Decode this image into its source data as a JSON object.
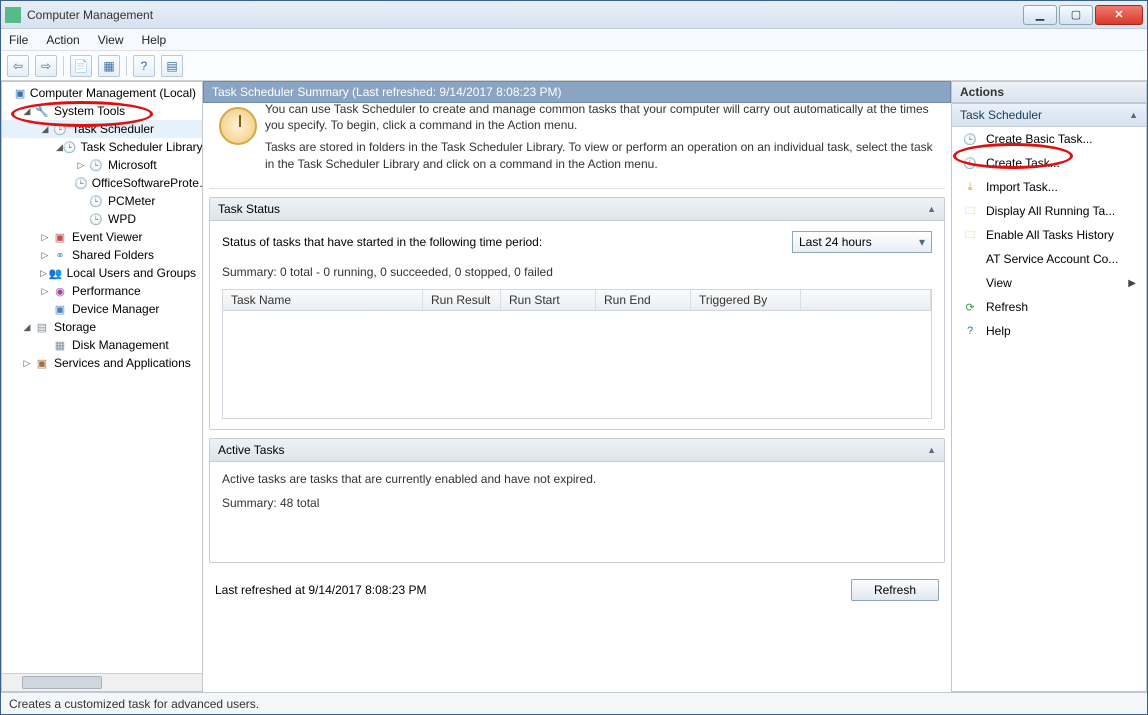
{
  "titlebar": {
    "title": "Computer Management"
  },
  "menubar": {
    "file": "File",
    "action": "Action",
    "view": "View",
    "help": "Help"
  },
  "tree": {
    "root": "Computer Management (Local)",
    "systools": "System Tools",
    "tasksched": "Task Scheduler",
    "tslib": "Task Scheduler Library",
    "microsoft": "Microsoft",
    "office": "OfficeSoftwareProte…",
    "pcmeter": "PCMeter",
    "wpd": "WPD",
    "event": "Event Viewer",
    "shared": "Shared Folders",
    "users": "Local Users and Groups",
    "perf": "Performance",
    "device": "Device Manager",
    "storage": "Storage",
    "disk": "Disk Management",
    "serv": "Services and Applications"
  },
  "center": {
    "header": "Task Scheduler Summary (Last refreshed: 9/14/2017 8:08:23 PM)",
    "intro1": "You can use Task Scheduler to create and manage common tasks that your computer will carry out automatically at the times you specify. To begin, click a command in the Action menu.",
    "intro2": "Tasks are stored in folders in the Task Scheduler Library. To view or perform an operation on an individual task, select the task in the Task Scheduler Library and click on a command in the Action menu.",
    "taskStatus": {
      "title": "Task Status",
      "label": "Status of tasks that have started in the following time period:",
      "period": "Last 24 hours",
      "summary": "Summary: 0 total - 0 running, 0 succeeded, 0 stopped, 0 failed",
      "cols": {
        "name": "Task Name",
        "result": "Run Result",
        "start": "Run Start",
        "end": "Run End",
        "trig": "Triggered By"
      }
    },
    "activeTasks": {
      "title": "Active Tasks",
      "desc": "Active tasks are tasks that are currently enabled and have not expired.",
      "summary": "Summary: 48 total"
    },
    "lastRefreshed": "Last refreshed at 9/14/2017 8:08:23 PM",
    "refreshBtn": "Refresh"
  },
  "actions": {
    "title": "Actions",
    "group": "Task Scheduler",
    "items": {
      "createBasic": "Create Basic Task...",
      "createTask": "Create Task...",
      "importTask": "Import Task...",
      "displayAll": "Display All Running Ta...",
      "enableHist": "Enable All Tasks History",
      "atService": "AT Service Account Co...",
      "view": "View",
      "refresh": "Refresh",
      "help": "Help"
    }
  },
  "statusbar": "Creates a customized task for advanced users."
}
